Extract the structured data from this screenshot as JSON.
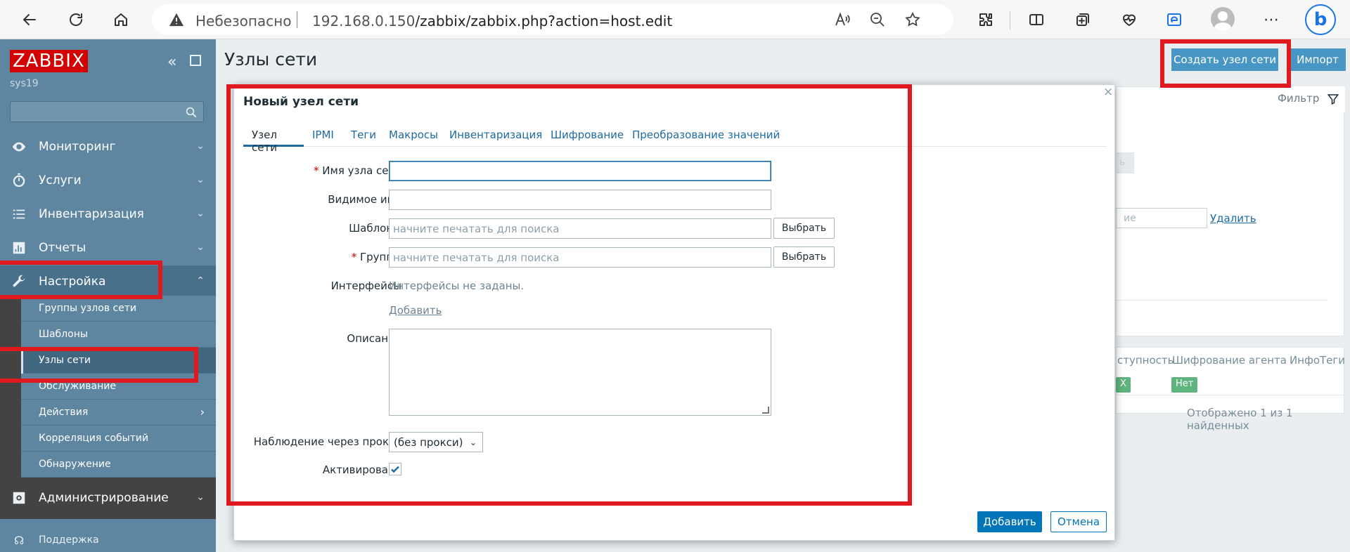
{
  "browser": {
    "security_label": "Небезопасно",
    "url_host": "192.168.0.150",
    "url_path": "/zabbix/zabbix.php?action=host.edit"
  },
  "sidebar": {
    "logo": "ZABBIX",
    "server_name": "sys19",
    "menu": [
      {
        "label": "Мониторинг",
        "icon": "eye-icon"
      },
      {
        "label": "Услуги",
        "icon": "clock-icon"
      },
      {
        "label": "Инвентаризация",
        "icon": "list-icon"
      },
      {
        "label": "Отчеты",
        "icon": "bar-chart-icon"
      },
      {
        "label": "Настройка",
        "icon": "wrench-icon"
      }
    ],
    "submenu": [
      {
        "label": "Группы узлов сети"
      },
      {
        "label": "Шаблоны"
      },
      {
        "label": "Узлы сети"
      },
      {
        "label": "Обслуживание"
      },
      {
        "label": "Действия"
      },
      {
        "label": "Корреляция событий"
      },
      {
        "label": "Обнаружение"
      }
    ],
    "admin_label": "Администрирование",
    "support_label": "Поддержка"
  },
  "page": {
    "title": "Узлы сети",
    "create_button": "Создать узел сети",
    "import_button": "Импорт",
    "filter_label": "Фильтр",
    "bg_delete_link": "Удалить",
    "bg_col_availability": "ступность",
    "bg_col_encryption": "Шифрование агента",
    "bg_col_info": "Инфо",
    "bg_col_tags": "Теги",
    "bg_tag_no": "Нет",
    "bg_tag_x": "X",
    "bg_footer": "Отображено 1 из 1 найденных",
    "bg_input_fragment": "ие",
    "bg_button_fragment": "ь"
  },
  "modal": {
    "title": "Новый узел сети",
    "close": "×",
    "tabs": [
      {
        "label": "Узел сети",
        "active": true
      },
      {
        "label": "IPMI"
      },
      {
        "label": "Теги"
      },
      {
        "label": "Макросы"
      },
      {
        "label": "Инвентаризация"
      },
      {
        "label": "Шифрование"
      },
      {
        "label": "Преобразование значений"
      }
    ],
    "fields": {
      "host_name_label": "Имя узла сети",
      "host_name_value": "",
      "visible_name_label": "Видимое имя",
      "visible_name_value": "",
      "templates_label": "Шаблоны",
      "templates_placeholder": "начните печатать для поиска",
      "templates_select": "Выбрать",
      "groups_label": "Группы",
      "groups_placeholder": "начните печатать для поиска",
      "groups_select": "Выбрать",
      "interfaces_label": "Интерфейсы",
      "interfaces_text": "Интерфейсы не заданы.",
      "interfaces_add": "Добавить",
      "description_label": "Описание",
      "proxy_label": "Наблюдение через прокси",
      "proxy_value": "(без прокси)",
      "enabled_label": "Активировано",
      "enabled_checked": true
    },
    "add_button": "Добавить",
    "cancel_button": "Отмена"
  },
  "colors": {
    "sidebar": "#5e86a1",
    "primary": "#0275b8",
    "annotation": "#e0191f"
  }
}
